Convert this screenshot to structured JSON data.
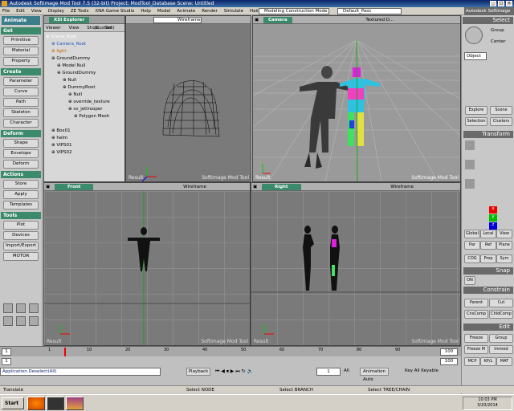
{
  "titlebar": {
    "title": "Autodesk Softimage Mod Tool 7.5 (32-bit)   Project: ModTool_Database   Scene: Untitled"
  },
  "menu": [
    "File",
    "Edit",
    "View",
    "Display",
    "ZE Tools",
    "XNA Game Studio",
    "Help",
    "Model",
    "Animate",
    "Render",
    "Simulate",
    "Hair"
  ],
  "toolbar": {
    "construction_mode": "Modeling Construction Mode",
    "pass": "Default_Pass",
    "brand": "Autodesk Softimage"
  },
  "left_panel": {
    "mode": "Animate",
    "sections": [
      {
        "title": "Get",
        "buttons": [
          "Primitive",
          "Material",
          "Property"
        ]
      },
      {
        "title": "Create",
        "buttons": [
          "Parameter",
          "Curve",
          "Path",
          "Skeleton",
          "Character"
        ]
      },
      {
        "title": "Deform",
        "buttons": [
          "Shape",
          "Envelope",
          "Deform"
        ]
      },
      {
        "title": "Actions",
        "buttons": [
          "Store",
          "Apply",
          "Templates"
        ]
      },
      {
        "title": "Tools",
        "buttons": [
          "Plot",
          "Devices",
          "Import/Export",
          "MOTOR"
        ]
      }
    ]
  },
  "explorer": {
    "header": "XSI Explorer",
    "toolbar": [
      "Viewer",
      "View",
      "Show",
      "Sel"
    ],
    "custom": "(Custom)",
    "tree": [
      {
        "label": "Scene_Root",
        "indent": 0,
        "color": "#fff"
      },
      {
        "label": "Camera_Root",
        "indent": 1,
        "color": "#2050c0"
      },
      {
        "label": "light",
        "indent": 1,
        "color": "#c06000"
      },
      {
        "label": "GroundDummy",
        "indent": 1,
        "color": "#000"
      },
      {
        "label": "Model Null",
        "indent": 2,
        "color": "#000"
      },
      {
        "label": "GroundDummy",
        "indent": 2,
        "color": "#000"
      },
      {
        "label": "Null",
        "indent": 3,
        "color": "#000"
      },
      {
        "label": "DummyRoot",
        "indent": 3,
        "color": "#000"
      },
      {
        "label": "Null",
        "indent": 4,
        "color": "#000"
      },
      {
        "label": "override_texture",
        "indent": 4,
        "color": "#000"
      },
      {
        "label": "sv_jettrooper",
        "indent": 4,
        "color": "#000"
      },
      {
        "label": "Polygon Mesh",
        "indent": 5,
        "color": "#000"
      },
      {
        "label": "",
        "indent": 0,
        "color": "#000"
      },
      {
        "label": "Box01",
        "indent": 1,
        "color": "#000"
      },
      {
        "label": "helm",
        "indent": 1,
        "color": "#000"
      },
      {
        "label": "VIPS01",
        "indent": 1,
        "color": "#000"
      },
      {
        "label": "VIPS02",
        "indent": 1,
        "color": "#000"
      }
    ]
  },
  "viewports": {
    "top_left": {
      "mode": "Wireframe",
      "label": "Result",
      "brand": "Softimage Mod Tool"
    },
    "top_right": {
      "camera": "Camera",
      "mode": "Textured D...",
      "label": "Result",
      "brand": "Softimage Mod Tool"
    },
    "bottom_left": {
      "camera": "Front",
      "mode": "Wireframe",
      "label": "Result",
      "brand": "Softimage Mod Tool"
    },
    "bottom_right": {
      "camera": "Right",
      "mode": "Wireframe",
      "label": "Result",
      "brand": "Softimage Mod Tool"
    }
  },
  "right_panel": {
    "title": "Select",
    "group": "Group",
    "center": "Center",
    "object": "Object",
    "explore": "Explore",
    "scene": "Scene",
    "selection": "Selection",
    "clusters": "Clusters",
    "transform": "Transform",
    "xyz": [
      "x",
      "y",
      "z"
    ],
    "ref_buttons": [
      "Global",
      "Local",
      "View",
      "Par",
      "Ref",
      "Plane",
      "COG",
      "Prop",
      "Sym"
    ],
    "snap": "Snap",
    "snap_on": "ON",
    "constrain": "Constrain",
    "constrain_buttons": [
      "Parent",
      "Cut",
      "CnsComp",
      "ChldComp"
    ],
    "edit": "Edit",
    "edit_buttons": [
      "Freeze",
      "Group",
      "Freeze M",
      "Immed",
      "MCP",
      "KP/L",
      "MAT"
    ]
  },
  "timeline": {
    "start": "1",
    "end": "100",
    "current": "1",
    "ticks": [
      "1",
      "10",
      "20",
      "30",
      "40",
      "50",
      "60",
      "70",
      "80",
      "90"
    ]
  },
  "playback": {
    "command": "Application.Deselect(All)",
    "playback_label": "Playback",
    "all_label": "All",
    "animation_label": "Animation",
    "auto_label": "Auto",
    "key_label": "Key All Keyable",
    "frame": "1"
  },
  "status": {
    "mode": "Translate",
    "hint1": "Select NODE",
    "hint2": "Select BRANCH",
    "hint3": "Select TREE/CHAIN"
  },
  "taskbar": {
    "start": "Start",
    "time": "10:03 PM",
    "date": "3/20/2014"
  },
  "colors": {
    "accent": "#3c8a6c",
    "mode": "#3c7d8a",
    "viewport": "#7a7a7a"
  }
}
